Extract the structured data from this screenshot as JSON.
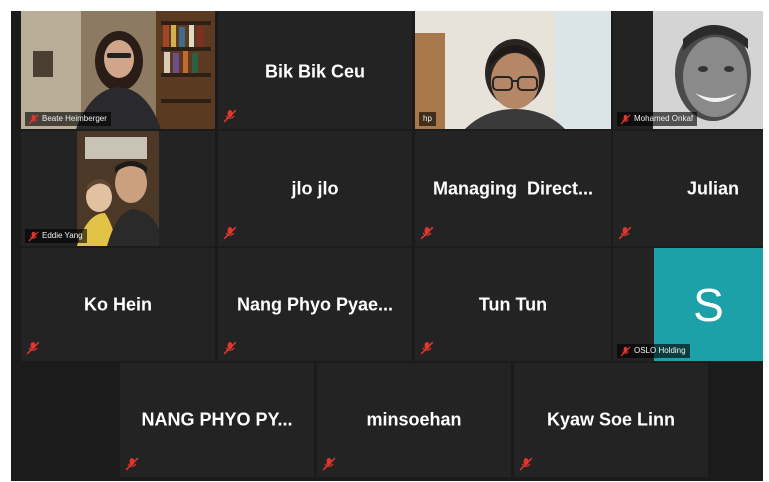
{
  "participants_row1": [
    {
      "display": "Beate Heimberger",
      "type": "video"
    },
    {
      "display": "Bik Bik Ceu",
      "type": "name"
    },
    {
      "display": "hp",
      "type": "video"
    },
    {
      "display": "Mohamed Onkaf",
      "type": "video"
    }
  ],
  "participants_row2": [
    {
      "display": "Eddie Yang",
      "type": "video"
    },
    {
      "display": "jlo jlo",
      "type": "name"
    },
    {
      "display": "Managing  Direct...",
      "type": "name"
    },
    {
      "display": "Julian",
      "type": "name"
    }
  ],
  "participants_row3": [
    {
      "display": "Ko Hein",
      "type": "name"
    },
    {
      "display": "Nang Phyo Pyae...",
      "type": "name"
    },
    {
      "display": "Tun Tun",
      "type": "name"
    },
    {
      "display": "OSLO Holding",
      "type": "avatar",
      "avatar_letter": "S"
    }
  ],
  "participants_row4": [
    {
      "display": "NANG PHYO PY...",
      "type": "name"
    },
    {
      "display": "minsoehan",
      "type": "name"
    },
    {
      "display": "Kyaw Soe Linn",
      "type": "name"
    }
  ],
  "colors": {
    "background": "#1b1b1b",
    "tile": "#232323",
    "active_speaker_border": "#d6e23a",
    "mute_icon": "#e0362c",
    "avatar_bg": "#1da1a8"
  },
  "icons": {
    "muted": "muted-mic-icon"
  }
}
